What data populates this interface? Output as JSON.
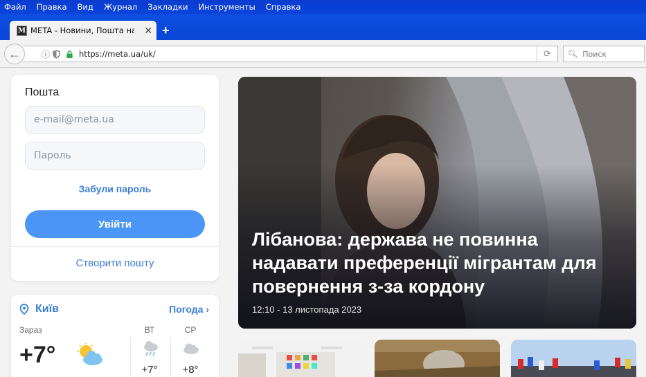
{
  "menu": [
    "Файл",
    "Правка",
    "Вид",
    "Журнал",
    "Закладки",
    "Инструменты",
    "Справка"
  ],
  "tab": {
    "favicon": "M",
    "title": "META - Новини, Пошта на п..."
  },
  "nav": {
    "url": "https://meta.ua/uk/",
    "search_placeholder": "Поиск"
  },
  "mail": {
    "title": "Пошта",
    "email_placeholder": "e-mail@meta.ua",
    "password_placeholder": "Пароль",
    "forgot": "Забули пароль",
    "login": "Увійти",
    "create": "Створити пошту"
  },
  "weather": {
    "city": "Київ",
    "forecast_link": "Погода ›",
    "now_label": "Зараз",
    "now_temp": "+7°",
    "days": [
      {
        "label": "ВТ",
        "temp": "+7°"
      },
      {
        "label": "СР",
        "temp": "+8°"
      }
    ]
  },
  "hero": {
    "headline": "Лібанова: держава не повинна надавати преференції мігрантам для повернення з-за кордону",
    "date": "12:10 - 13 листопада 2023"
  },
  "colors": {
    "menubar": "#0b43db",
    "accent": "#3b7fd4",
    "button": "#4a95f5"
  }
}
